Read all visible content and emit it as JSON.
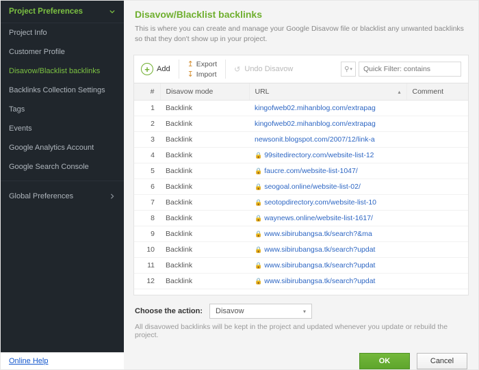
{
  "sidebar": {
    "section1_title": "Project Preferences",
    "items": [
      "Project Info",
      "Customer Profile",
      "Disavow/Blacklist backlinks",
      "Backlinks Collection Settings",
      "Tags",
      "Events",
      "Google Analytics Account",
      "Google Search Console"
    ],
    "active_index": 2,
    "section2_title": "Global Preferences",
    "help_link": "Online Help"
  },
  "header": {
    "title": "Disavow/Blacklist backlinks",
    "desc": "This is where you can create and manage your Google Disavow file or blacklist any unwanted backlinks so that they don't show up in your project."
  },
  "toolbar": {
    "add_label": "Add",
    "export_label": "Export",
    "import_label": "Import",
    "undo_label": "Undo Disavow",
    "search_placeholder": "Quick Filter: contains",
    "search_drop_glyph": "⚲"
  },
  "columns": {
    "num": "#",
    "mode": "Disavow mode",
    "url": "URL",
    "comment": "Comment"
  },
  "rows": [
    {
      "n": 1,
      "mode": "Backlink",
      "url": "kingofweb02.mihanblog.com/extrapag",
      "lock": false
    },
    {
      "n": 2,
      "mode": "Backlink",
      "url": "kingofweb02.mihanblog.com/extrapag",
      "lock": false
    },
    {
      "n": 3,
      "mode": "Backlink",
      "url": "newsonit.blogspot.com/2007/12/link-a",
      "lock": false
    },
    {
      "n": 4,
      "mode": "Backlink",
      "url": "99sitedirectory.com/website-list-12",
      "lock": true
    },
    {
      "n": 5,
      "mode": "Backlink",
      "url": "faucre.com/website-list-1047/",
      "lock": true
    },
    {
      "n": 6,
      "mode": "Backlink",
      "url": "seogoal.online/website-list-02/",
      "lock": true
    },
    {
      "n": 7,
      "mode": "Backlink",
      "url": "seotopdirectory.com/website-list-10",
      "lock": true
    },
    {
      "n": 8,
      "mode": "Backlink",
      "url": "waynews.online/website-list-1617/",
      "lock": true
    },
    {
      "n": 9,
      "mode": "Backlink",
      "url": "www.sibirubangsa.tk/search?&ma",
      "lock": true
    },
    {
      "n": 10,
      "mode": "Backlink",
      "url": "www.sibirubangsa.tk/search?updat",
      "lock": true
    },
    {
      "n": 11,
      "mode": "Backlink",
      "url": "www.sibirubangsa.tk/search?updat",
      "lock": true
    },
    {
      "n": 12,
      "mode": "Backlink",
      "url": "www.sibirubangsa.tk/search?updat",
      "lock": true
    }
  ],
  "footer": {
    "action_label": "Choose the action:",
    "action_value": "Disavow",
    "note": "All disavowed backlinks will be kept in the project and updated whenever you update or rebuild the project.",
    "ok_label": "OK",
    "cancel_label": "Cancel"
  }
}
